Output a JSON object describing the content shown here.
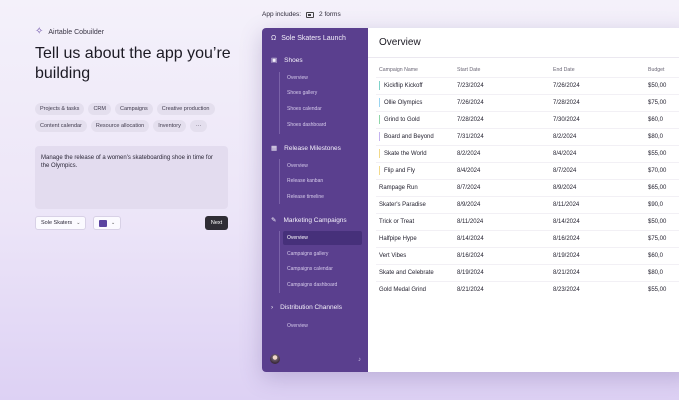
{
  "brand": {
    "name": "Airtable Cobuilder",
    "icon": "sparkle-icon"
  },
  "headline": "Tell us about the app you’re building",
  "chips": [
    "Projects & tasks",
    "CRM",
    "Campaigns",
    "Creative production",
    "Content calendar",
    "Resource allocation",
    "Inventory",
    "···"
  ],
  "prompt_text": "Manage the release of a women's skateboarding shoe in time for the Olympics.",
  "controls": {
    "company": "Sole Skaters",
    "color": "#5a43a0",
    "next_label": "Next"
  },
  "app_includes": {
    "label": "App includes:",
    "forms_count": "2 forms"
  },
  "sidebar": {
    "app_name": "Sole Skaters Launch",
    "sections": [
      {
        "label": "Shoes",
        "icon": "box-icon",
        "items": [
          "Overview",
          "Shoes gallery",
          "Shoes calendar",
          "Shoes dashboard"
        ]
      },
      {
        "label": "Release Milestones",
        "icon": "calendar-icon",
        "items": [
          "Overview",
          "Release kanban",
          "Release timeline"
        ]
      },
      {
        "label": "Marketing Campaigns",
        "icon": "megaphone-icon",
        "items": [
          "Overview",
          "Campaigns gallery",
          "Campaigns calendar",
          "Campaigns dashboard"
        ]
      },
      {
        "label": "Distribution Channels",
        "icon": "chevron-right-icon",
        "items": [
          "Overview"
        ]
      }
    ],
    "active_item": "Marketing Campaigns / Overview"
  },
  "main": {
    "title": "Overview",
    "columns": [
      "Campaign Name",
      "Start Date",
      "End Date",
      "Budget"
    ],
    "rows": [
      [
        "Kickflip Kickoff",
        "7/23/2024",
        "7/26/2024",
        "$50,00"
      ],
      [
        "Ollie Olympics",
        "7/26/2024",
        "7/28/2024",
        "$75,00"
      ],
      [
        "Grind to Gold",
        "7/28/2024",
        "7/30/2024",
        "$60,0"
      ],
      [
        "Board and Beyond",
        "7/31/2024",
        "8/2/2024",
        "$80,0"
      ],
      [
        "Skate the World",
        "8/2/2024",
        "8/4/2024",
        "$55,00"
      ],
      [
        "Flip and Fly",
        "8/4/2024",
        "8/7/2024",
        "$70,00"
      ],
      [
        "Rampage Run",
        "8/7/2024",
        "8/9/2024",
        "$65,00"
      ],
      [
        "Skater's Paradise",
        "8/9/2024",
        "8/11/2024",
        "$90,0"
      ],
      [
        "Trick or Treat",
        "8/11/2024",
        "8/14/2024",
        "$50,00"
      ],
      [
        "Halfpipe Hype",
        "8/14/2024",
        "8/16/2024",
        "$75,00"
      ],
      [
        "Vert Vibes",
        "8/16/2024",
        "8/19/2024",
        "$60,0"
      ],
      [
        "Skate and Celebrate",
        "8/19/2024",
        "8/21/2024",
        "$80,0"
      ],
      [
        "Gold Medal Grind",
        "8/21/2024",
        "8/23/2024",
        "$55,00"
      ]
    ],
    "row_marker_colors": [
      "#7fd3c9",
      "#9ad4f0",
      "#8fd6a8",
      "#c4b3f0",
      "#f2d98a",
      "#f2d98a"
    ]
  }
}
